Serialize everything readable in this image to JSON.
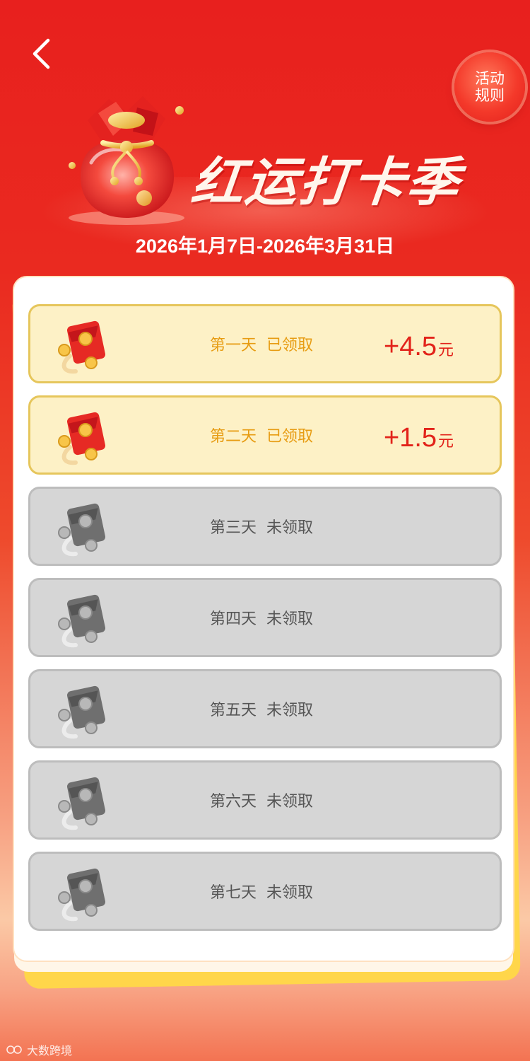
{
  "header": {
    "back_icon": "chevron-left-icon",
    "rules_button": {
      "line1": "活动",
      "line2": "规则"
    },
    "title": "红运打卡季",
    "date_range": "2026年1月7日-2026年3月31日"
  },
  "days": [
    {
      "label": "第一天",
      "status": "已领取",
      "state": "claimed",
      "amount": "+4.5",
      "unit": "元"
    },
    {
      "label": "第二天",
      "status": "已领取",
      "state": "claimed",
      "amount": "+1.5",
      "unit": "元"
    },
    {
      "label": "第三天",
      "status": "未领取",
      "state": "unclaimed"
    },
    {
      "label": "第四天",
      "status": "未领取",
      "state": "unclaimed"
    },
    {
      "label": "第五天",
      "status": "未领取",
      "state": "unclaimed"
    },
    {
      "label": "第六天",
      "status": "未领取",
      "state": "unclaimed"
    },
    {
      "label": "第七天",
      "status": "未领取",
      "state": "unclaimed"
    }
  ],
  "watermark": "大数跨境",
  "colors": {
    "brand_red": "#e8201e",
    "claimed_bg": "#fdf1c6",
    "claimed_text": "#e79c12",
    "unclaimed_bg": "#d6d6d6",
    "amount_red": "#e2231a"
  }
}
